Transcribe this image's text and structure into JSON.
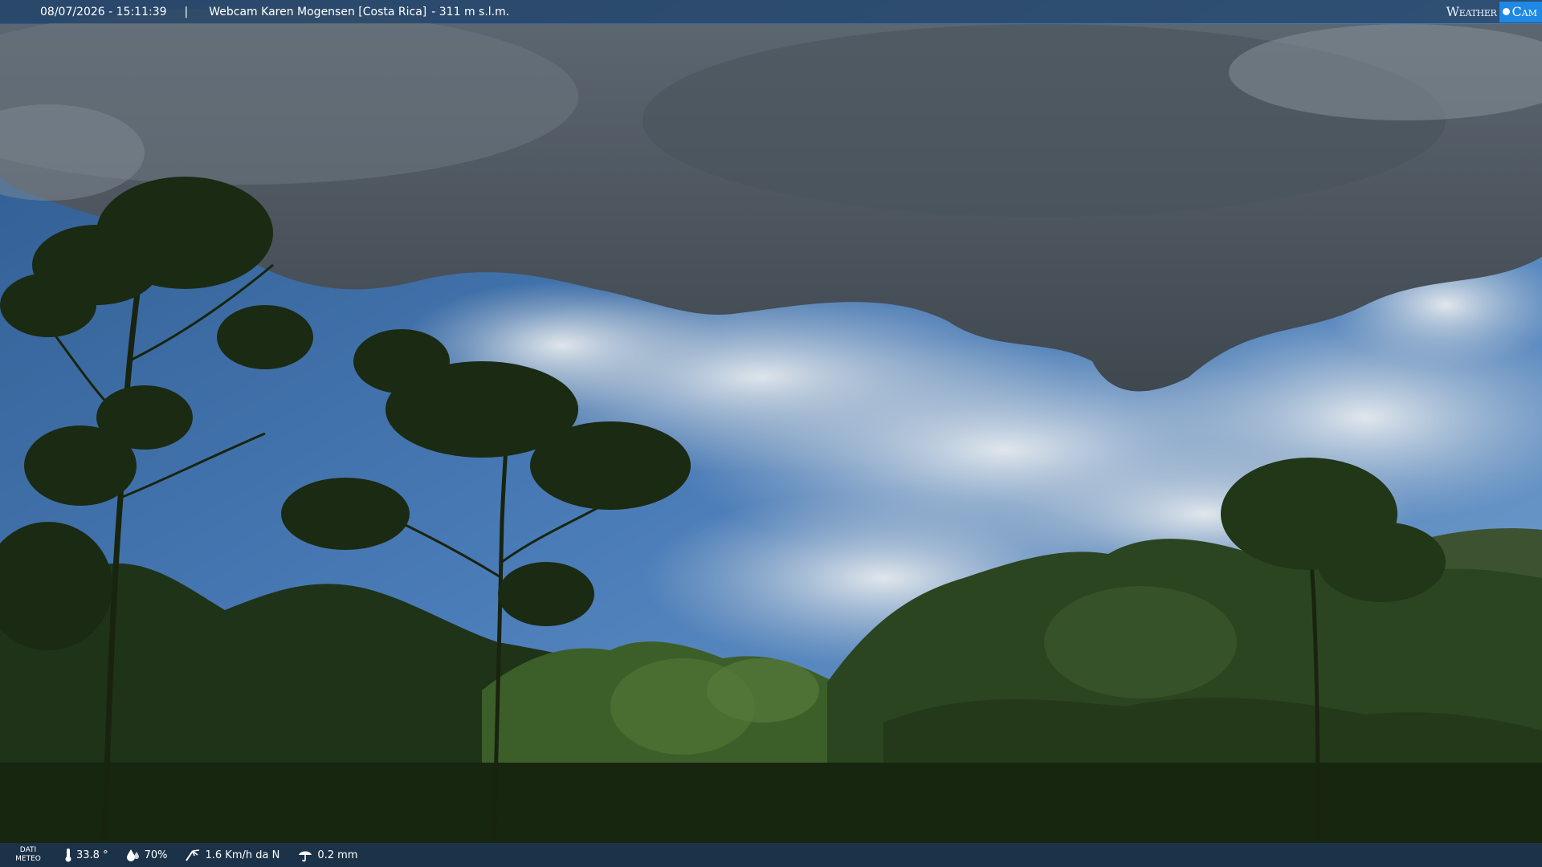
{
  "header": {
    "datetime": "08/07/2026 - 15:11:39",
    "separator": "|",
    "location": "Webcam Karen Mogensen [Costa Rica]",
    "altitude": "- 311 m s.l.m."
  },
  "logo": {
    "part1": "Weather",
    "part2": "Cam"
  },
  "weather_bar": {
    "label_line1": "DATI",
    "label_line2": "METEO",
    "temperature": "33.8 °",
    "humidity": "70%",
    "wind": "1.6 Km/h da N",
    "rain": "0.2 mm"
  },
  "colors": {
    "bar": "#2a4466",
    "logo_accent": "#1e88e5"
  },
  "icons": [
    "thermometer-icon",
    "humidity-icon",
    "wind-icon",
    "rain-icon"
  ]
}
